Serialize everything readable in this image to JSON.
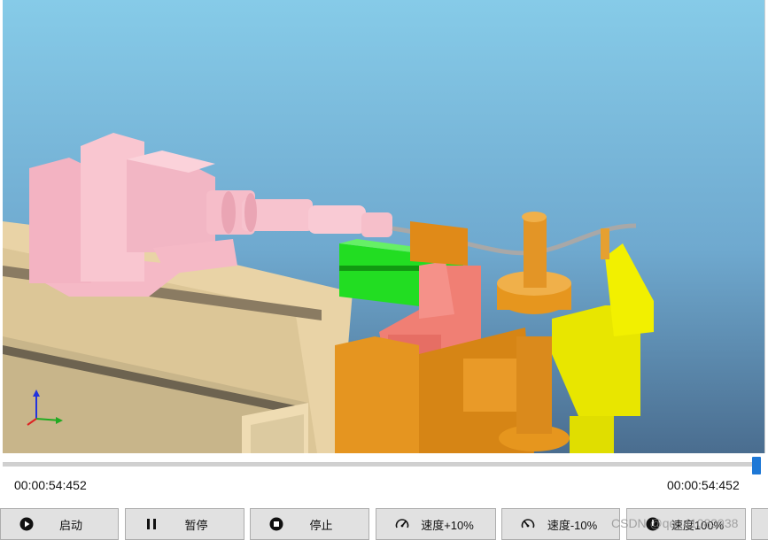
{
  "player": {
    "time_current": "00:00:54:452",
    "time_total": "00:00:54:452",
    "progress": 1.0
  },
  "controls": {
    "start_label": "启动",
    "pause_label": "暂停",
    "stop_label": "停止",
    "speed_up_label": "速度+10%",
    "speed_down_label": "速度-10%",
    "speed_reset_label": "速度100%"
  },
  "icons": {
    "start": "play-icon",
    "pause": "pause-icon",
    "stop": "stop-icon",
    "speed_up": "speedometer-up-icon",
    "speed_down": "speedometer-down-icon",
    "speed_reset": "speedometer-reset-icon"
  },
  "colors": {
    "sky_top": "#86cbe8",
    "sky_bottom": "#4a6d8f",
    "bed": "#e9d3a6",
    "carriage": "#f4b8c4",
    "clamp_green": "#22dd22",
    "die_salmon": "#f07f74",
    "bend_head": "#e59520",
    "pressure_die": "#e8e600",
    "tube": "#a8a8a8",
    "progress_handle": "#1e78d6"
  },
  "watermark": "CSDN @qq_41082938"
}
